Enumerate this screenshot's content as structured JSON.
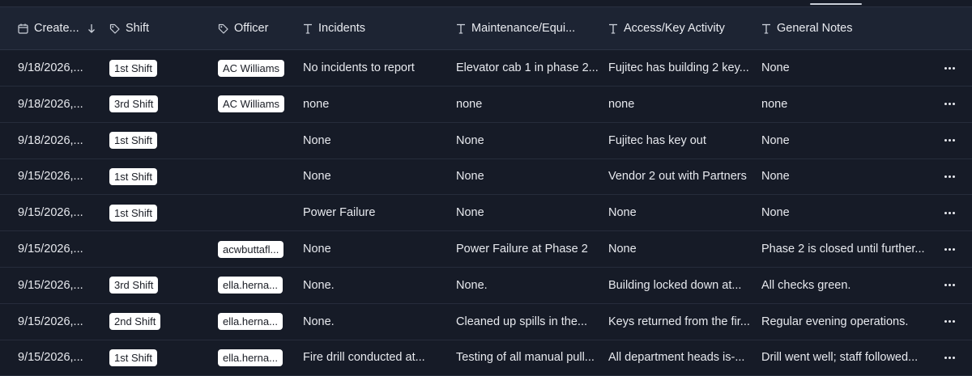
{
  "columns": {
    "created": "Create...",
    "shift": "Shift",
    "officer": "Officer",
    "incidents": "Incidents",
    "maintenance": "Maintenance/Equi...",
    "access": "Access/Key Activity",
    "notes": "General Notes"
  },
  "icons": {
    "created": "calendar-icon",
    "shift": "tag-icon",
    "officer": "tag-icon",
    "text_columns": "text-type-icon",
    "sort": "arrow-down-icon",
    "row_actions": "more-horizontal-icon"
  },
  "rows": [
    {
      "created": "9/18/2026,...",
      "shift": "1st Shift",
      "officer": "AC Williams",
      "incidents": "No incidents to report",
      "maintenance": "Elevator cab 1 in phase 2...",
      "access": "Fujitec has building 2 key...",
      "notes": "None"
    },
    {
      "created": "9/18/2026,...",
      "shift": "3rd Shift",
      "officer": "AC Williams",
      "incidents": "none",
      "maintenance": "none",
      "access": "none",
      "notes": "none"
    },
    {
      "created": "9/18/2026,...",
      "shift": "1st Shift",
      "officer": "",
      "incidents": "None",
      "maintenance": "None",
      "access": "Fujitec has key out",
      "notes": "None"
    },
    {
      "created": "9/15/2026,...",
      "shift": "1st Shift",
      "officer": "",
      "incidents": "None",
      "maintenance": "None",
      "access": "Vendor 2 out with Partners",
      "notes": "None"
    },
    {
      "created": "9/15/2026,...",
      "shift": "1st Shift",
      "officer": "",
      "incidents": "Power Failure",
      "maintenance": "None",
      "access": "None",
      "notes": "None"
    },
    {
      "created": "9/15/2026,...",
      "shift": "",
      "officer": "acwbuttafl...",
      "incidents": "None",
      "maintenance": "Power Failure at Phase 2",
      "access": "None",
      "notes": "Phase 2 is closed until further..."
    },
    {
      "created": "9/15/2026,...",
      "shift": "3rd Shift",
      "officer": "ella.herna...",
      "incidents": "None.",
      "maintenance": "None.",
      "access": "Building locked down at...",
      "notes": "All checks green."
    },
    {
      "created": "9/15/2026,...",
      "shift": "2nd Shift",
      "officer": "ella.herna...",
      "incidents": "None.",
      "maintenance": "Cleaned up spills in the...",
      "access": "Keys returned from the fir...",
      "notes": "Regular evening operations."
    },
    {
      "created": "9/15/2026,...",
      "shift": "1st Shift",
      "officer": "ella.herna...",
      "incidents": "Fire drill conducted at...",
      "maintenance": "Testing of all manual pull...",
      "access": "All department heads is-...",
      "notes": "Drill went well; staff followed..."
    }
  ]
}
